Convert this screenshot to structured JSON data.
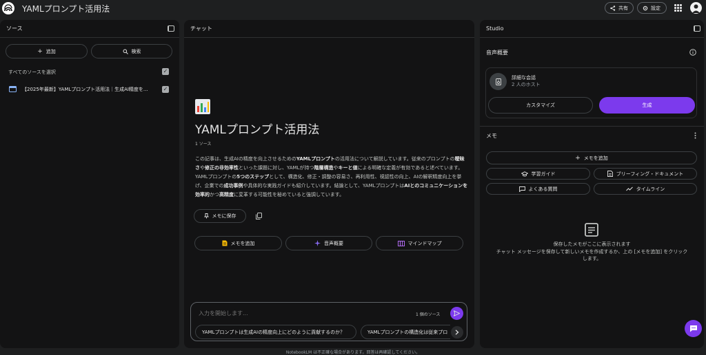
{
  "header": {
    "title": "YAMLプロンプト活用法",
    "share_label": "共有",
    "settings_label": "設定"
  },
  "sources": {
    "title": "ソース",
    "add_label": "追加",
    "search_label": "検索",
    "select_all_label": "すべてのソースを選択",
    "items": [
      {
        "title": "【2025年最新】YAMLプロンプト活用法｜生成AI精度を..."
      }
    ]
  },
  "chat": {
    "title": "チャット",
    "emoji": "📊",
    "notebook_title": "YAMLプロンプト活用法",
    "source_count": "1 ソース",
    "summary_lines": [
      [
        {
          "t": "この記事は、生成AIの精度を向上させるための"
        },
        {
          "t": "YAMLプロンプト",
          "b": true
        },
        {
          "t": "の活用法について解説しています。従来のプロンプトの"
        },
        {
          "t": "曖昧",
          "b": true
        }
      ],
      [
        {
          "t": "さ",
          "b": true
        },
        {
          "t": "や"
        },
        {
          "t": "修正の非効率性",
          "b": true
        },
        {
          "t": "といった課題に対し、YAMLが持つ"
        },
        {
          "t": "階層構造",
          "b": true
        },
        {
          "t": "や"
        },
        {
          "t": "キーと値",
          "b": true
        },
        {
          "t": "による明確な定義が有効であると述べています。"
        }
      ],
      [
        {
          "t": "YAMLプロンプトの"
        },
        {
          "t": "5つのステップ",
          "b": true
        },
        {
          "t": "として、構造化、修正・調整の容易さ、再利用性、視認性の向上、AIの解釈精度向上を挙"
        }
      ],
      [
        {
          "t": "げ、企業での"
        },
        {
          "t": "成功事例",
          "b": true
        },
        {
          "t": "や具体的な実践ガイドも紹介しています。結論として、YAMLプロンプトは"
        },
        {
          "t": "AIとのコミュニケーションを",
          "b": true
        }
      ],
      [
        {
          "t": "効率的",
          "b": true
        },
        {
          "t": "かつ"
        },
        {
          "t": "高精度",
          "b": true
        },
        {
          "t": "に変革する可能性を秘めていると強調しています。"
        }
      ]
    ],
    "save_note_label": "メモに保存",
    "actions": [
      "メモを追加",
      "音声概要",
      "マインドマップ"
    ],
    "input_placeholder": "入力を開始します...",
    "input_source_count": "1 個のソース",
    "suggestions": [
      "YAMLプロンプトは生成AIの精度向上にどのように貢献するのか？",
      "YAMLプロンプトの構造化は従来プロ"
    ]
  },
  "studio": {
    "title": "Studio",
    "audio_title": "音声概要",
    "audio_card_title": "詳細な会話",
    "audio_card_subtitle": "2 人のホスト",
    "customize_label": "カスタマイズ",
    "generate_label": "生成",
    "notes_title": "メモ",
    "add_note_label": "メモを追加",
    "note_buttons": [
      "学習ガイド",
      "ブリーフィング・ドキュメント",
      "よくある質問",
      "タイムライン"
    ],
    "empty_line1": "保存したメモがここに表示されます",
    "empty_line2": "チャット メッセージを保存して新しいメモを作成するか、上の [メモを追加] をクリック",
    "empty_line3": "します。"
  },
  "footer": {
    "disclaimer": "NotebookLM は不正確な場合があります。回答は再確認してください。"
  },
  "colors": {
    "accent_purple": "#7c3aed",
    "panel_bg": "#131314",
    "page_bg": "#1e1f20"
  }
}
